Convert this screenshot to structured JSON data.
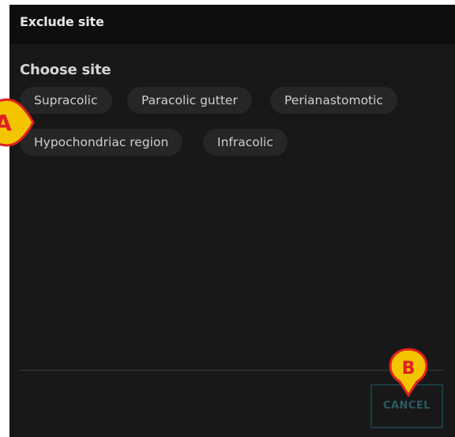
{
  "dialog": {
    "title": "Exclude site",
    "section_title": "Choose site",
    "sites": [
      {
        "label": "Supracolic"
      },
      {
        "label": "Paracolic gutter"
      },
      {
        "label": "Perianastomotic"
      },
      {
        "label": "Hypochondriac region"
      },
      {
        "label": "Infracolic"
      }
    ],
    "cancel_label": "CANCEL"
  },
  "annotations": {
    "marker_a": "A",
    "marker_b": "B"
  },
  "colors": {
    "dialog_background": "#181818",
    "header_background": "#0e0e0e",
    "chip_background": "#262626",
    "cancel_border": "#1b3a41",
    "marker_fill": "#f5c400",
    "marker_border": "#e02020"
  }
}
